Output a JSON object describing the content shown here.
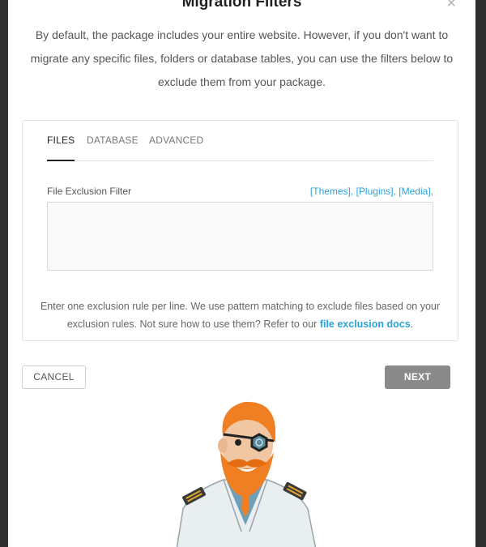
{
  "modal": {
    "title": "Migration Filters",
    "close_glyph": "×",
    "description": "By default, the package includes your entire website. However, if you don't want to migrate any specific files, folders or database tables, you can use the filters below to exclude them from your package."
  },
  "tabs": [
    {
      "label": "FILES",
      "active": true
    },
    {
      "label": "DATABASE",
      "active": false
    },
    {
      "label": "ADVANCED",
      "active": false
    }
  ],
  "file_filter": {
    "label": "File Exclusion Filter",
    "quick_links": [
      "[Themes]",
      "[Plugins]",
      "[Media]"
    ],
    "separator": ", ",
    "trailing": ",",
    "value": ""
  },
  "help": {
    "text": "Enter one exclusion rule per line. We use pattern matching to exclude files based on your exclusion rules. Not sure how to use them? Refer to our ",
    "link": "file exclusion docs",
    "end": "."
  },
  "buttons": {
    "cancel": "CANCEL",
    "next": "NEXT"
  },
  "colors": {
    "accent": "#2aa3d8",
    "next_disabled": "#8a8a8a",
    "backdrop": "#2f2f2f",
    "beard": "#f07f23"
  },
  "icons": {
    "close": "close-icon",
    "mascot": "pirate-captain-mascot"
  }
}
